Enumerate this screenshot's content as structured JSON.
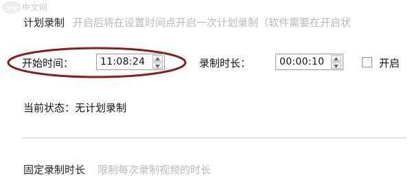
{
  "watermark": {
    "text": "中文网",
    "logo_text": "php",
    "logo_color": "#e8e8e8"
  },
  "scheduled_recording": {
    "title": "计划录制",
    "description": "开启后将在设置时间点开启一次计划录制（软件需要在开启状",
    "start_time_label": "开始时间：",
    "start_time_value": "11:08:24",
    "duration_label": "录制时长：",
    "duration_value": "00:00:10",
    "enable_label": "开启",
    "enable_checked": false,
    "status_text": "当前状态：无计划录制"
  },
  "fixed_duration": {
    "title": "固定录制时长",
    "description": "限制每次录制视频的时长"
  },
  "colors": {
    "highlight_ellipse": "#8b1a1a",
    "desc_gray": "#b9b9b9",
    "divider": "#c8c8c8"
  },
  "icons": {
    "spin_up": "chevron-up-icon",
    "spin_down": "chevron-down-icon"
  }
}
